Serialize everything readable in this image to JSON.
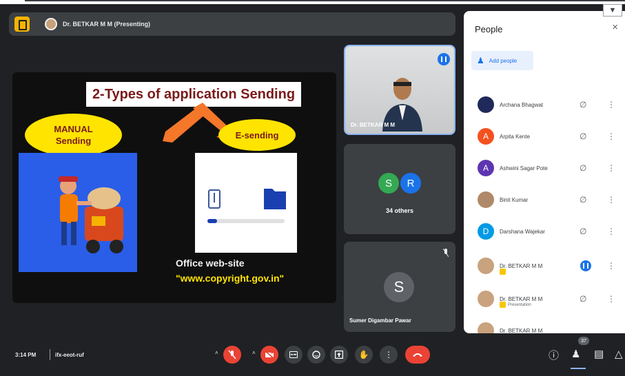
{
  "presentation": {
    "presenter_label": "Dr. BETKAR M M (Presenting)"
  },
  "slide": {
    "title": "2-Types of  application Sending",
    "manual_line1": "MANUAL",
    "manual_line2": "Sending",
    "esending": "E-sending",
    "office_line1": "Office web-site",
    "office_line2": "\"www.copyright.gov.in\""
  },
  "tiles": {
    "presenter_tile_name": "Dr. BETKAR M M",
    "others_initial_1": "S",
    "others_initial_2": "R",
    "others_label": "34 others",
    "participant_initial": "S",
    "participant_name": "Sumer Digambar Pawar"
  },
  "people_panel": {
    "title": "People",
    "close": "×",
    "add_people": "Add people",
    "participants": [
      {
        "initial": "",
        "name": "Archana Bhagwat",
        "color": "#1f2a5a"
      },
      {
        "initial": "A",
        "name": "Arpita Kente",
        "color": "#f4511e"
      },
      {
        "initial": "A",
        "name": "Ashwini Sagar Pote",
        "color": "#5e35b1"
      },
      {
        "initial": "",
        "name": "Binit Kumar",
        "color": "#b08968"
      },
      {
        "initial": "D",
        "name": "Darshana Wajekar",
        "color": "#039be5"
      },
      {
        "initial": "",
        "name": "Dr. BETKAR M M",
        "color": "#c9a27e"
      },
      {
        "initial": "",
        "name": "Dr. BETKAR M M",
        "sub": "Presentation",
        "color": "#c9a27e"
      },
      {
        "initial": "",
        "name": "Dr. BETKAR M M",
        "color": "#c9a27e"
      }
    ]
  },
  "bottom_bar": {
    "time": "3:14 PM",
    "meeting_code": "ifx-eeot-ruf",
    "people_count": "37"
  },
  "colors": {
    "accent_blue": "#1a73e8",
    "danger_red": "#ea4335",
    "slide_yellow": "#ffe400",
    "meet_dark": "#202124"
  }
}
